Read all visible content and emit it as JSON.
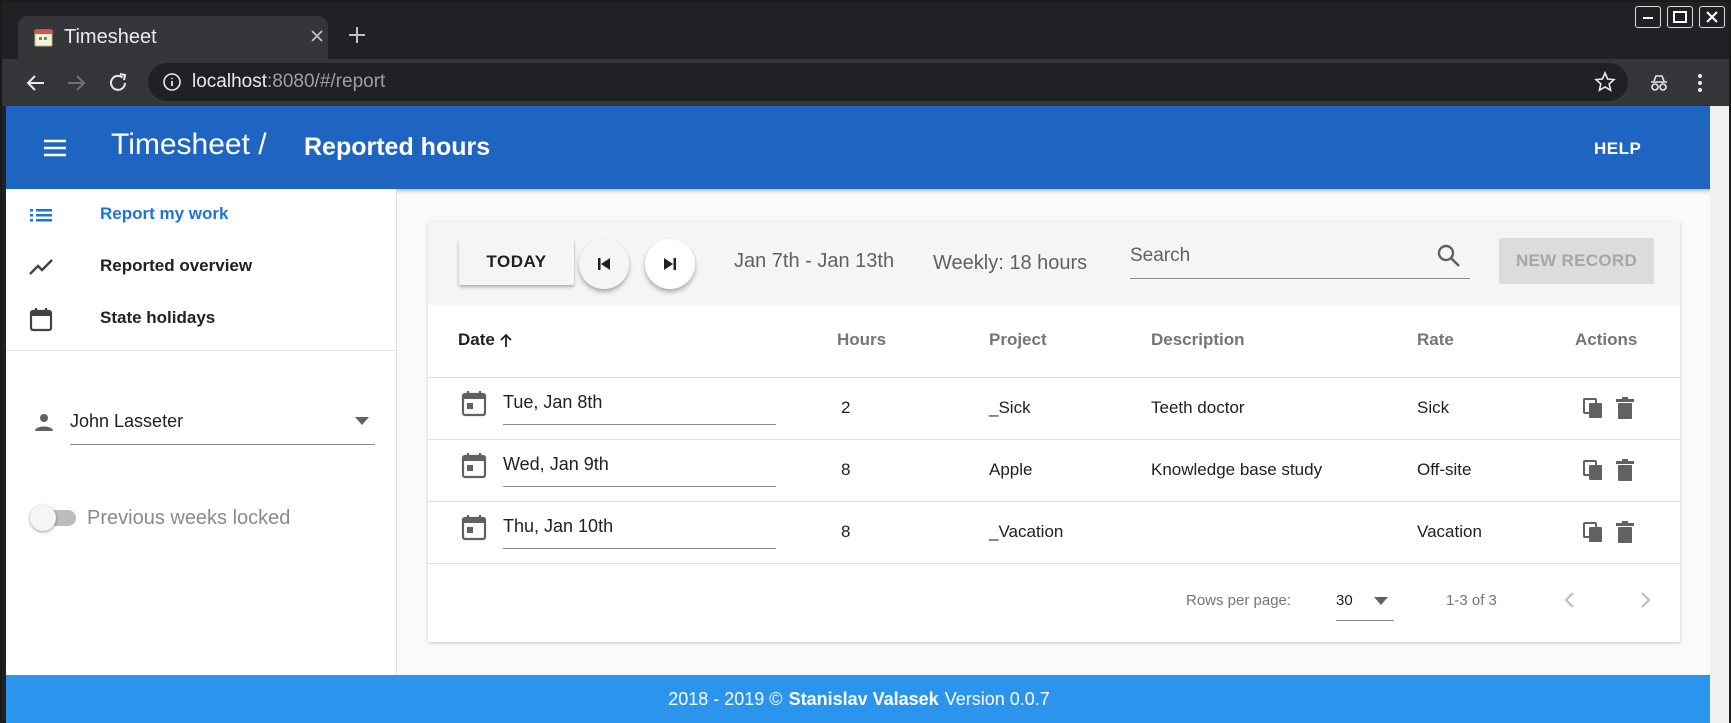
{
  "browser": {
    "tab_title": "Timesheet",
    "url_host": "localhost",
    "url_path": ":8080/#/report"
  },
  "appbar": {
    "title": "Timesheet /",
    "page_title": "Reported hours",
    "help_label": "HELP"
  },
  "sidebar": {
    "items": [
      {
        "label": "Report my work",
        "icon": "list-icon",
        "active": true
      },
      {
        "label": "Reported overview",
        "icon": "trending-icon",
        "active": false
      },
      {
        "label": "State holidays",
        "icon": "calendar-icon",
        "active": false
      }
    ],
    "user": "John Lasseter",
    "lock_label": "Previous weeks locked",
    "lock_enabled": false
  },
  "toolbar": {
    "today_label": "TODAY",
    "range": "Jan 7th - Jan 13th",
    "weekly": "Weekly: 18 hours",
    "search_placeholder": "Search",
    "new_record_label": "NEW RECORD"
  },
  "table": {
    "headers": {
      "date": "Date",
      "hours": "Hours",
      "project": "Project",
      "description": "Description",
      "rate": "Rate",
      "actions": "Actions"
    },
    "rows": [
      {
        "date": "Tue, Jan 8th",
        "hours": "2",
        "project": "_Sick",
        "description": "Teeth doctor",
        "rate": "Sick"
      },
      {
        "date": "Wed, Jan 9th",
        "hours": "8",
        "project": "Apple",
        "description": "Knowledge base study",
        "rate": "Off-site"
      },
      {
        "date": "Thu, Jan 10th",
        "hours": "8",
        "project": "_Vacation",
        "description": "",
        "rate": "Vacation"
      }
    ]
  },
  "pagination": {
    "rows_per_page_label": "Rows per page:",
    "rows_per_page": "30",
    "range": "1-3 of 3"
  },
  "footer": {
    "years": "2018 - 2019 ©",
    "author": "Stanislav Valasek",
    "version": "Version 0.0.7"
  },
  "colors": {
    "appbar": "#1e65c2",
    "footer": "#2b95ee",
    "active_nav": "#1e73d8"
  }
}
